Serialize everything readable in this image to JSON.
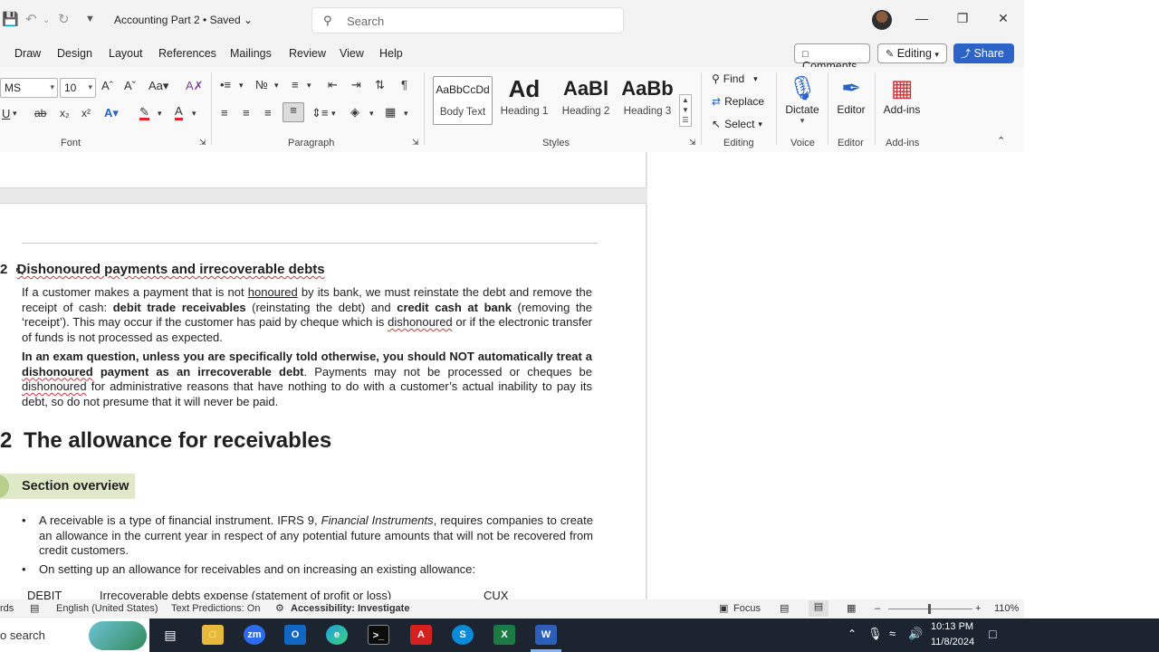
{
  "titlebar": {
    "doc_title": "Accounting Part 2 • Saved ⌄",
    "search_placeholder": "Search",
    "minimize_glyph": "—",
    "restore_glyph": "❐",
    "close_glyph": "✕"
  },
  "tabs": [
    "Draw",
    "Design",
    "Layout",
    "References",
    "Mailings",
    "Review",
    "View",
    "Help"
  ],
  "actions": {
    "comments": "Comments",
    "editing": "Editing",
    "share": "Share"
  },
  "ribbon": {
    "font_name": "MS",
    "font_size": "10",
    "groups": {
      "font": "Font",
      "paragraph": "Paragraph",
      "styles": "Styles",
      "editing": "Editing",
      "voice": "Voice",
      "editor": "Editor",
      "addins": "Add-ins"
    },
    "styles": [
      {
        "preview": "AaBbCcDd",
        "name": "Body Text"
      },
      {
        "preview": "Ad",
        "name": "Heading 1"
      },
      {
        "preview": "AaBl",
        "name": "Heading 2"
      },
      {
        "preview": "AaBb",
        "name": "Heading 3"
      }
    ],
    "find": "Find",
    "replace": "Replace",
    "select": "Select",
    "dictate": "Dictate",
    "editor": "Editor",
    "addins": "Add-ins"
  },
  "document": {
    "h_dishon_num": "2",
    "h_dishon_title": "Dishonoured payments and irrecoverable debts",
    "p1": {
      "a": "If a customer makes a payment that is not ",
      "b": "honoured",
      "c": " by its bank, we must reinstate the debt and remove the receipt of cash: ",
      "d": "debit trade receivables",
      "e": " (reinstating the debt) and ",
      "f": "credit cash at bank",
      "g": " (removing the ‘receipt’). This may occur if the customer has paid by cheque which is ",
      "h": "dishonoured",
      "i": " or if the electronic transfer of funds is not processed as expected."
    },
    "p2": {
      "a": "In an exam question, unless you are specifically told otherwise, you should NOT automatically treat a ",
      "b": "dishonoured",
      "c": " payment as an irrecoverable debt",
      "d": ". Payments may not be processed or cheques be ",
      "e": "dishonoured",
      "f": " for administrative reasons that have nothing to do with a customer’s actual inability to pay its debt, so do not presume that it will never be paid."
    },
    "h_allow_num": "2",
    "h_allow_title": "The allowance for receivables",
    "section_overview": "Section overview",
    "bullet1": {
      "a": "A receivable is a type of financial instrument. IFRS 9, ",
      "b": "Financial Instruments",
      "c": ", requires companies to create an allowance in the current year in respect of any potential future amounts that will not be recovered from credit customers."
    },
    "bullet2": "On setting up an allowance for receivables and on increasing an existing allowance:",
    "debit_row": {
      "dr": "DEBIT",
      "desc": "Irrecoverable debts expense (statement of profit or loss)",
      "amt": "CUX"
    }
  },
  "statusbar": {
    "words": "rds",
    "language": "English (United States)",
    "text_predictions": "Text Predictions: On",
    "accessibility": "Accessibility: Investigate",
    "focus": "Focus",
    "zoom": "110%"
  },
  "taskbar": {
    "search": "o search",
    "time": "10:13 PM",
    "date": "11/8/2024"
  }
}
